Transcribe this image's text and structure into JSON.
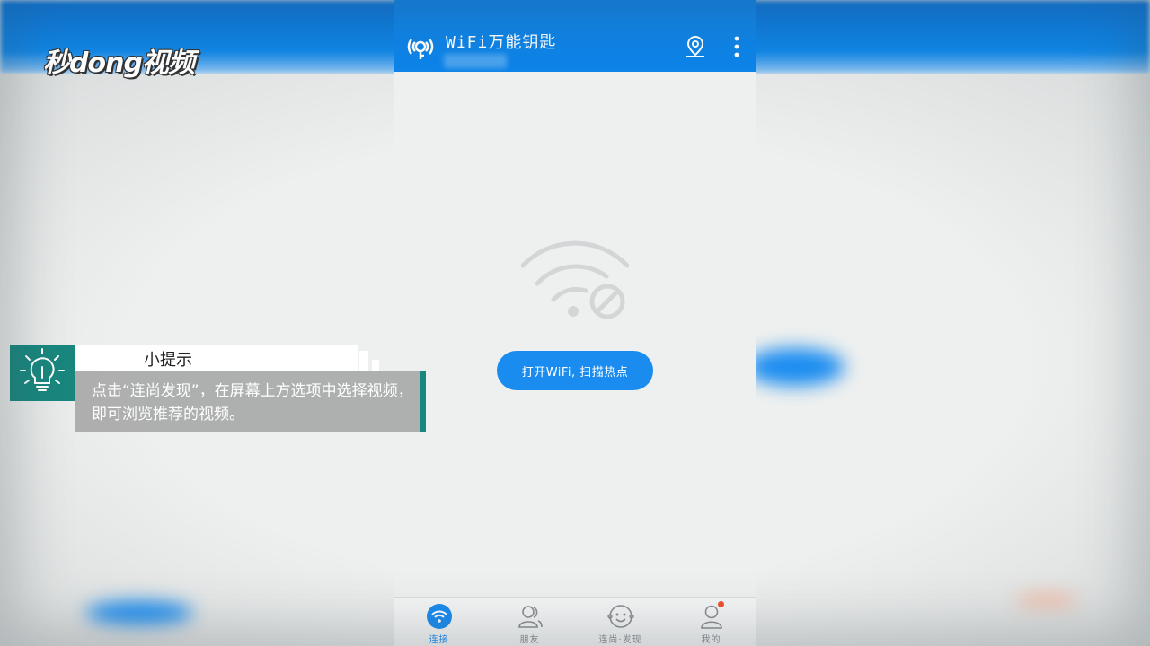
{
  "watermark": {
    "logo_text": "秒dong视频"
  },
  "app": {
    "title": "WiFi万能钥匙",
    "icons": {
      "logo": "wifi-key-logo-icon",
      "location": "location-pin-icon",
      "more": "more-vertical-icon"
    },
    "accent_color": "#0e84e8"
  },
  "main": {
    "status_icon": "wifi-disabled-icon",
    "scan_button_label": "打开WiFi, 扫描热点"
  },
  "tabbar": {
    "tabs": [
      {
        "label": "连接",
        "icon": "wifi-connect-icon",
        "active": true
      },
      {
        "label": "朋友",
        "icon": "friends-icon",
        "active": false
      },
      {
        "label": "连尚·发现",
        "icon": "discover-face-icon",
        "active": false
      },
      {
        "label": "我的",
        "icon": "profile-icon",
        "active": false,
        "badge": true
      }
    ]
  },
  "tip": {
    "title": "小提示",
    "icon": "lightbulb-icon",
    "text": "点击“连尚发现”，在屏幕上方选项中选择视频，即可浏览推荐的视频。"
  }
}
